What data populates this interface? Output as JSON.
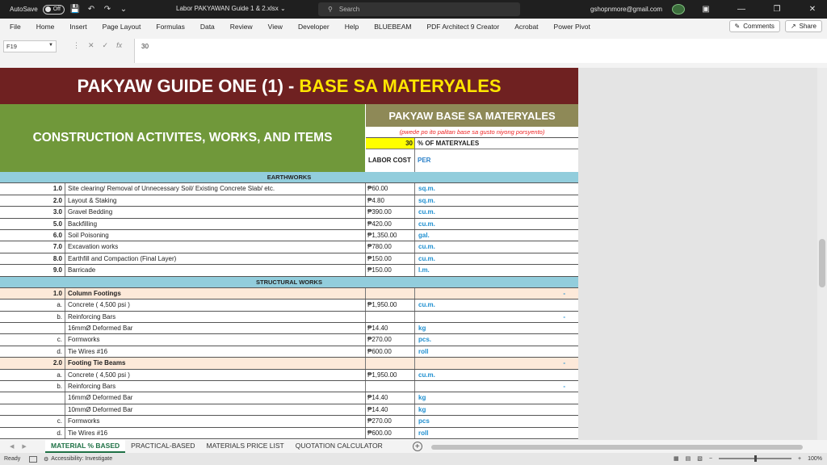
{
  "titlebar": {
    "autosave_label": "AutoSave",
    "autosave_state": "Off",
    "doc_title": "Labor PAKYAWAN Guide 1 & 2.xlsx",
    "search_placeholder": "Search",
    "user_email": "gshopnmore@gmail.com"
  },
  "menu": [
    "File",
    "Home",
    "Insert",
    "Page Layout",
    "Formulas",
    "Data",
    "Review",
    "View",
    "Developer",
    "Help",
    "BLUEBEAM",
    "PDF Architect 9 Creator",
    "Acrobat",
    "Power Pivot"
  ],
  "ribbon": {
    "comments_label": "Comments",
    "share_label": "Share"
  },
  "formula": {
    "cell_ref": "F19",
    "value": "30"
  },
  "sheet": {
    "banner_white": "PAKYAW GUIDE ONE (1) -",
    "banner_yellow": "BASE SA MATERYALES",
    "left_header": "CONSTRUCTION ACTIVITES, WORKS, AND ITEMS",
    "right_header": "PAKYAW BASE SA MATERYALES",
    "note": "(pwede po ito palitan base sa gusto niyong porsyento)",
    "percent_value": "30",
    "percent_label": "% OF MATERYALES",
    "labor_cost_label": "LABOR COST",
    "per_label": "PER"
  },
  "rows": [
    {
      "type": "section",
      "desc": "EARTHWORKS"
    },
    {
      "type": "item",
      "num": "1.0",
      "desc": "Site clearing/ Removal of Unnecessary Soil/ Existing Concrete Slab/ etc.",
      "cost": "₱60.00",
      "unit": "sq.m."
    },
    {
      "type": "item",
      "num": "2.0",
      "desc": "Layout & Staking",
      "cost": "₱4.80",
      "unit": "sq.m."
    },
    {
      "type": "item",
      "num": "3.0",
      "desc": "Gravel Bedding",
      "cost": "₱390.00",
      "unit": "cu.m."
    },
    {
      "type": "item",
      "num": "5.0",
      "desc": "Backfilling",
      "cost": "₱420.00",
      "unit": "cu.m."
    },
    {
      "type": "item",
      "num": "6.0",
      "desc": "Soil Poisoning",
      "cost": "₱1,350.00",
      "unit": "gal."
    },
    {
      "type": "item",
      "num": "7.0",
      "desc": "Excavation works",
      "cost": "₱780.00",
      "unit": "cu.m."
    },
    {
      "type": "item",
      "num": "8.0",
      "desc": "Earthfill and Compaction (Final Layer)",
      "cost": "₱150.00",
      "unit": "cu.m."
    },
    {
      "type": "item",
      "num": "9.0",
      "desc": "Barricade",
      "cost": "₱150.00",
      "unit": "l.m."
    },
    {
      "type": "section",
      "desc": "STRUCTURAL WORKS"
    },
    {
      "type": "sub",
      "num": "1.0",
      "desc": "Column Footings",
      "cost": "",
      "unit": "",
      "dash": "-"
    },
    {
      "type": "item",
      "num": "a.",
      "desc": "Concrete ( 4,500 psi )",
      "cost": "₱1,950.00",
      "unit": "cu.m."
    },
    {
      "type": "item",
      "num": "b.",
      "desc": "Reinforcing Bars",
      "cost": "",
      "unit": "",
      "dash": "-"
    },
    {
      "type": "item",
      "num": "",
      "desc": "16mmØ Deformed Bar",
      "cost": "₱14.40",
      "unit": "kg"
    },
    {
      "type": "item",
      "num": "c.",
      "desc": "Formworks",
      "cost": "₱270.00",
      "unit": "pcs."
    },
    {
      "type": "item",
      "num": "d.",
      "desc": "Tie Wires #16",
      "cost": "₱600.00",
      "unit": "roll"
    },
    {
      "type": "sub",
      "num": "2.0",
      "desc": "Footing Tie Beams",
      "cost": "",
      "unit": "",
      "dash": "-"
    },
    {
      "type": "item",
      "num": "a.",
      "desc": "Concrete ( 4,500 psi )",
      "cost": "₱1,950.00",
      "unit": "cu.m."
    },
    {
      "type": "item",
      "num": "b.",
      "desc": "Reinforcing Bars",
      "cost": "",
      "unit": "",
      "dash": "-"
    },
    {
      "type": "item",
      "num": "",
      "desc": "16mmØ Deformed Bar",
      "cost": "₱14.40",
      "unit": "kg"
    },
    {
      "type": "item",
      "num": "",
      "desc": "10mmØ Deformed Bar",
      "cost": "₱14.40",
      "unit": "kg"
    },
    {
      "type": "item",
      "num": "c.",
      "desc": "Formworks",
      "cost": "₱270.00",
      "unit": "pcs"
    },
    {
      "type": "item",
      "num": "d.",
      "desc": "Tie Wires #16",
      "cost": "₱600.00",
      "unit": "roll"
    }
  ],
  "tabs": [
    {
      "label": "MATERIAL % BASED",
      "active": true
    },
    {
      "label": "PRACTICAL-BASED",
      "active": false
    },
    {
      "label": "MATERIALS PRICE LIST",
      "active": false
    },
    {
      "label": "QUOTATION CALCULATOR",
      "active": false
    }
  ],
  "status": {
    "ready": "Ready",
    "accessibility": "Accessibility: Investigate",
    "zoom": "100%"
  }
}
